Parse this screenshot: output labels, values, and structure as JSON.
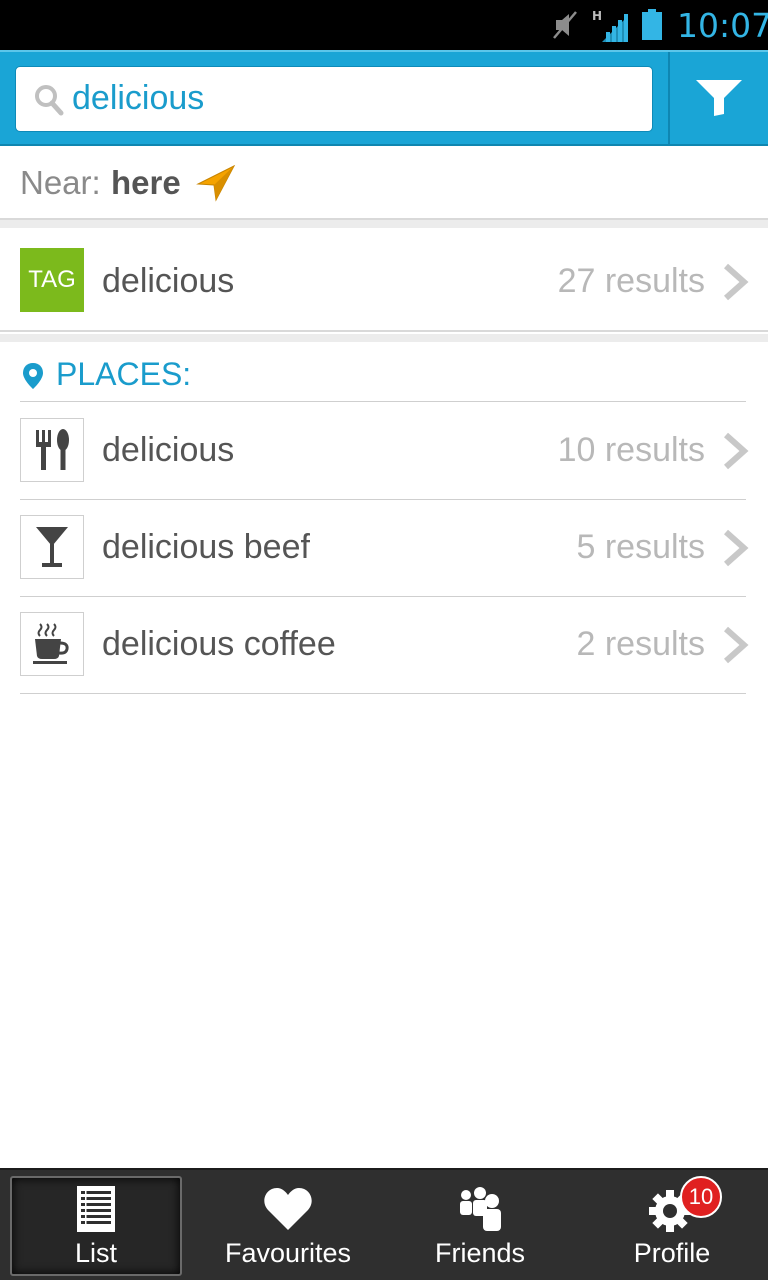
{
  "status_bar": {
    "time": "10:07",
    "icons": [
      "mute-icon",
      "signal-h-icon",
      "battery-icon"
    ]
  },
  "search": {
    "value": "delicious",
    "filter_icon": "funnel-icon"
  },
  "near": {
    "label": "Near:",
    "value": "here",
    "icon": "location-arrow-icon"
  },
  "tag_result": {
    "badge": "TAG",
    "title": "delicious",
    "count": "27 results"
  },
  "places": {
    "header": "PLACES:",
    "items": [
      {
        "icon": "cutlery-icon",
        "title": "delicious",
        "count": "10 results"
      },
      {
        "icon": "cocktail-glass-icon",
        "title": "delicious beef",
        "count": "5 results"
      },
      {
        "icon": "coffee-cup-icon",
        "title": "delicious coffee",
        "count": "2 results"
      }
    ]
  },
  "bottom_nav": {
    "items": [
      {
        "label": "List",
        "icon": "list-icon",
        "active": true
      },
      {
        "label": "Favourites",
        "icon": "heart-icon"
      },
      {
        "label": "Friends",
        "icon": "friends-icon"
      },
      {
        "label": "Profile",
        "icon": "gear-icon"
      }
    ],
    "profile_badge": "10"
  },
  "colors": {
    "accent": "#1aa5d6",
    "tag_green": "#7cba1c",
    "status_blue": "#33b5e5",
    "location_orange": "#f5a300",
    "badge_red": "#e02020"
  }
}
